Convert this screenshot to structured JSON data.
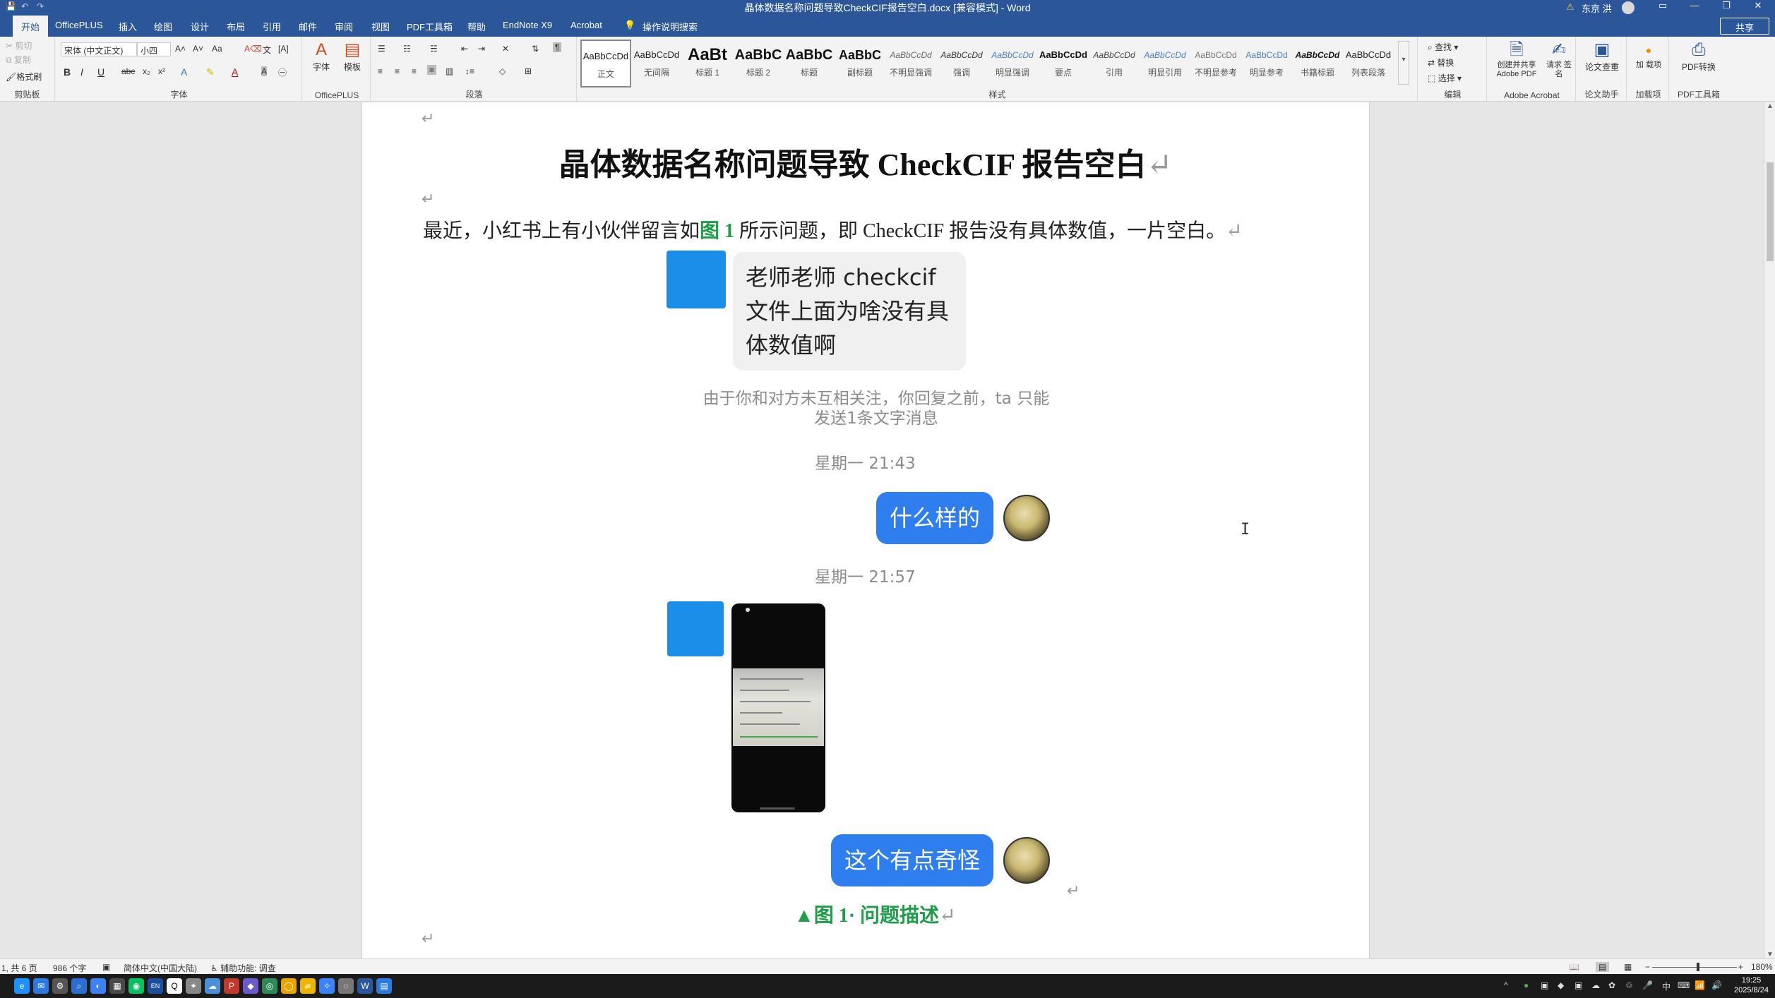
{
  "window": {
    "title": "晶体数据名称问题导致CheckCIF报告空白.docx [兼容模式] - Word",
    "user": "东京 洪",
    "warning_icon": "warning-icon"
  },
  "quick_access": [
    "save-icon",
    "undo-icon",
    "redo-icon"
  ],
  "tabs": [
    "开始",
    "OfficePLUS",
    "插入",
    "绘图",
    "设计",
    "布局",
    "引用",
    "邮件",
    "审阅",
    "视图",
    "PDF工具箱",
    "帮助",
    "EndNote X9",
    "Acrobat",
    "操作说明搜索"
  ],
  "share_label": "共享",
  "ribbon": {
    "clipboard": {
      "label": "剪贴板",
      "cut": "剪切",
      "copy": "复制",
      "format_painter": "格式刷"
    },
    "font": {
      "label": "字体",
      "font_name": "宋体 (中文正文)",
      "font_size": "小四"
    },
    "officeplus": {
      "label": "OfficePLUS",
      "font_btn": "字体",
      "template_btn": "模板"
    },
    "paragraph": {
      "label": "段落"
    },
    "styles": {
      "label": "样式",
      "items": [
        {
          "sample": "AaBbCcDd",
          "name": "正文"
        },
        {
          "sample": "AaBbCcDd",
          "name": "无间隔"
        },
        {
          "sample": "AaBt",
          "name": "标题 1"
        },
        {
          "sample": "AaBbC",
          "name": "标题 2"
        },
        {
          "sample": "AaBbC",
          "name": "标题"
        },
        {
          "sample": "AaBbC",
          "name": "副标题"
        },
        {
          "sample": "AaBbCcDd",
          "name": "不明显强调"
        },
        {
          "sample": "AaBbCcDd",
          "name": "强调"
        },
        {
          "sample": "AaBbCcDd",
          "name": "明显强调"
        },
        {
          "sample": "AaBbCcDd",
          "name": "要点"
        },
        {
          "sample": "AaBbCcDd",
          "name": "引用"
        },
        {
          "sample": "AaBbCcDd",
          "name": "明显引用"
        },
        {
          "sample": "AaBbCcDd",
          "name": "不明显参考"
        },
        {
          "sample": "AaBbCcDd",
          "name": "明显参考"
        },
        {
          "sample": "AaBbCcDd",
          "name": "书籍标题"
        },
        {
          "sample": "AaBbCcDd",
          "name": "列表段落"
        }
      ]
    },
    "editing": {
      "label": "编辑",
      "find": "查找",
      "replace": "替换",
      "select": "选择"
    },
    "acrobat": {
      "label": "Adobe Acrobat",
      "create_share": "创建并共享 Adobe PDF",
      "request_sign": "请求 签名"
    },
    "paper": {
      "label": "论文助手",
      "check": "论文查重"
    },
    "addins": {
      "label": "加载项",
      "btn": "加 载项"
    },
    "pdf": {
      "label": "PDF工具箱",
      "btn": "PDF转换"
    }
  },
  "document": {
    "title": "晶体数据名称问题导致 CheckCIF 报告空白",
    "intro_before": "最近，小红书上有小伙伴留言如",
    "intro_fig": "图 1",
    "intro_after": " 所示问题，即 CheckCIF 报告没有具体数值，一片空白。",
    "chat": {
      "message1": "老师老师 checkcif 文件上面为啥没有具体数值啊",
      "notice": "由于你和对方未互相关注，你回复之前，ta 只能发送1条文字消息",
      "time1": "星期一 21:43",
      "reply1": "什么样的",
      "time2": "星期一 21:57",
      "reply2": "这个有点奇怪"
    },
    "caption": "▲图 1· 问题描述"
  },
  "status": {
    "page": "1, 共 6 页",
    "words": "986 个字",
    "language": "简体中文(中国大陆)",
    "accessibility": "辅助功能: 调查",
    "zoom": "180%"
  },
  "taskbar": {
    "apps": [
      "edge-icon",
      "mail-icon",
      "settings-icon",
      "search-icon",
      "browser-icon",
      "calculator-icon",
      "wechat-icon",
      "endnote-icon",
      "qq-icon",
      "app-icon",
      "cloud-icon",
      "pdf-icon",
      "diamond-icon",
      "app2-icon",
      "chrome-icon",
      "explorer-icon",
      "app3-icon",
      "app4-icon",
      "word-icon",
      "notes-icon"
    ],
    "tray_lang": "中",
    "time": "19:25",
    "date": "2025/8/24"
  }
}
